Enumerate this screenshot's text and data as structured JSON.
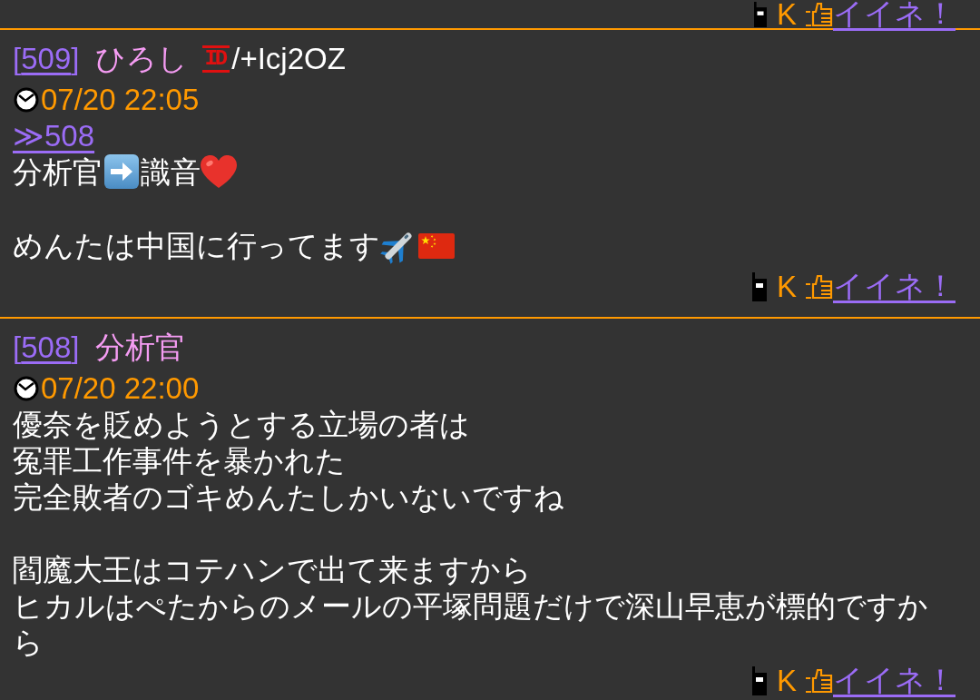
{
  "previous_post": {
    "footer": {
      "carrier": "K",
      "like_link": "イイネ！"
    }
  },
  "posts": [
    {
      "number_prefix": "[",
      "number": "509",
      "number_suffix": "]",
      "name": "ひろし",
      "id_badge": "ID",
      "id": "/+Icj2OZ",
      "date": "07/20 22:05",
      "reply_link": "≫508",
      "body": [
        [
          [
            {
              "kind": "text",
              "text": "分析官"
            },
            {
              "kind": "arrow"
            },
            {
              "kind": "text",
              "text": "識音"
            },
            {
              "kind": "heart"
            }
          ]
        ],
        [
          [
            {
              "kind": "text",
              "text": "めんたは中国に行ってます"
            },
            {
              "kind": "airplane"
            },
            {
              "kind": "flag"
            }
          ]
        ]
      ],
      "footer": {
        "carrier": "K",
        "like_link": "イイネ！"
      }
    },
    {
      "number_prefix": "[",
      "number": "508",
      "number_suffix": "]",
      "name": "分析官",
      "date": "07/20 22:00",
      "body": [
        [
          [
            {
              "kind": "text",
              "text": "優奈を貶めようとする立場の者は"
            }
          ],
          [
            {
              "kind": "text",
              "text": "冤罪工作事件を暴かれた"
            }
          ],
          [
            {
              "kind": "text",
              "text": "完全敗者のゴキめんたしかいないですね"
            }
          ]
        ],
        [
          [
            {
              "kind": "text",
              "text": "閻魔大王はコテハンで出て来ますから"
            }
          ],
          [
            {
              "kind": "text",
              "text": "ヒカルはぺたからのメールの平塚問題だけで深山早恵が標的ですから"
            }
          ]
        ]
      ],
      "footer": {
        "carrier": "K",
        "like_link": "イイネ！"
      }
    }
  ]
}
